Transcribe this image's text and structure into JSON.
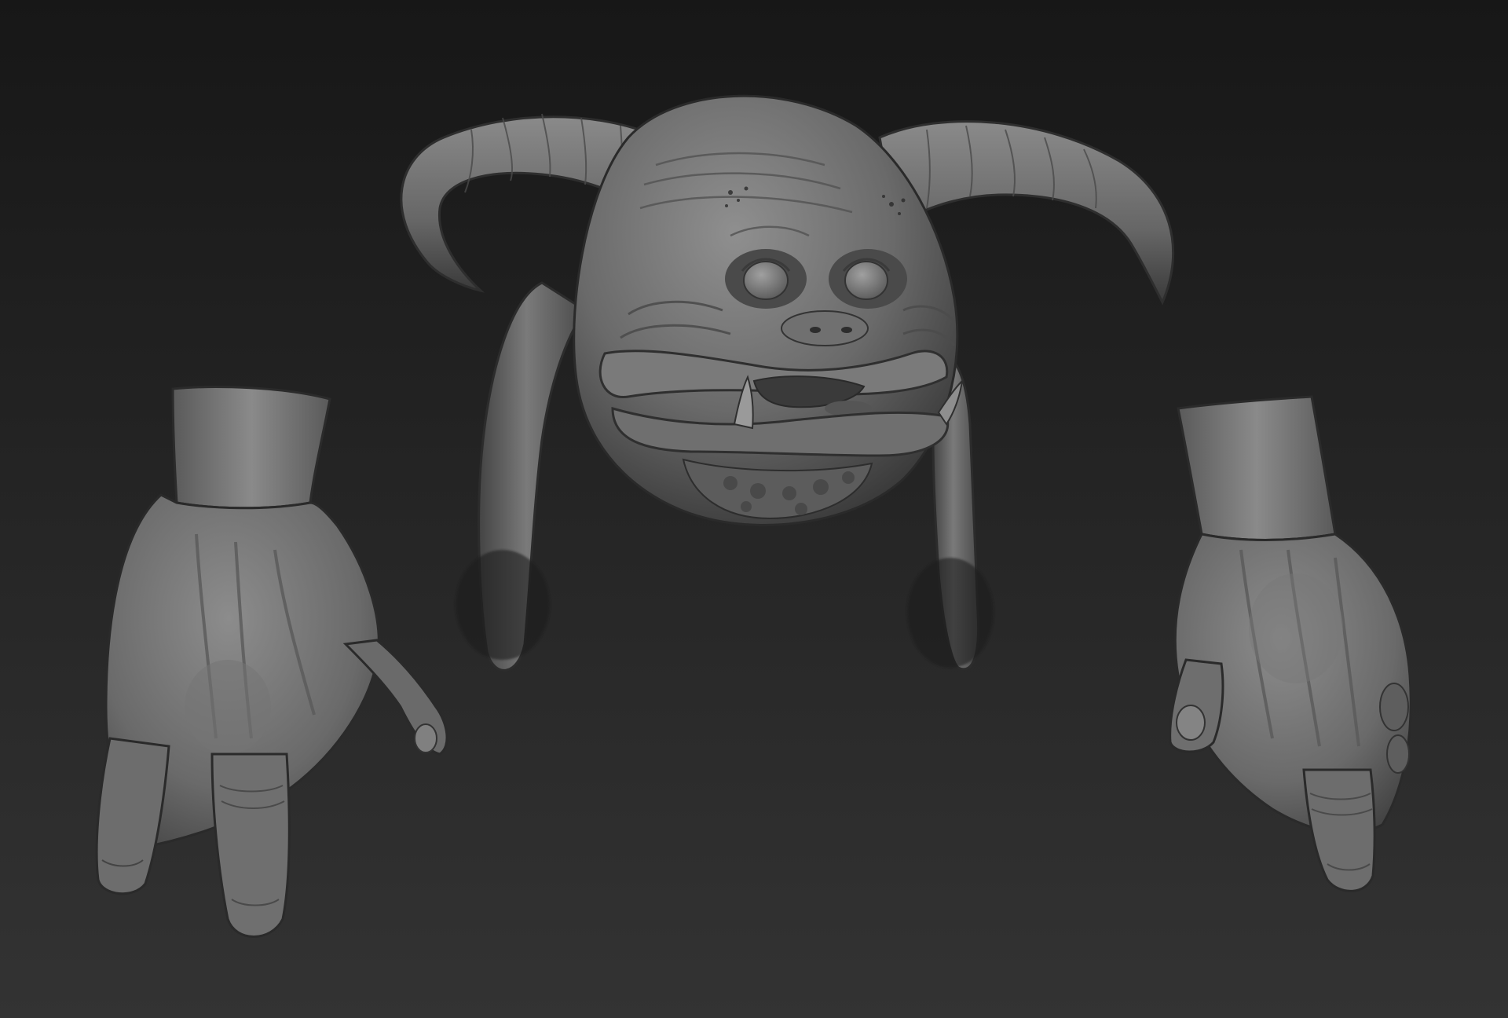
{
  "scene": {
    "background_top": "#171717",
    "background_bottom": "#333333",
    "clay_light": "#8f8f8f",
    "clay_mid": "#6e6e6e",
    "clay_dark": "#3f3f3f",
    "clay_shadow": "#262626",
    "objects": [
      {
        "name": "creature-head-sculpt",
        "horns": 2,
        "ears": 2,
        "tusks": 2
      },
      {
        "name": "left-hand-sculpt",
        "visible_fingers": 3
      },
      {
        "name": "right-hand-sculpt",
        "visible_fingers": 2
      }
    ]
  }
}
